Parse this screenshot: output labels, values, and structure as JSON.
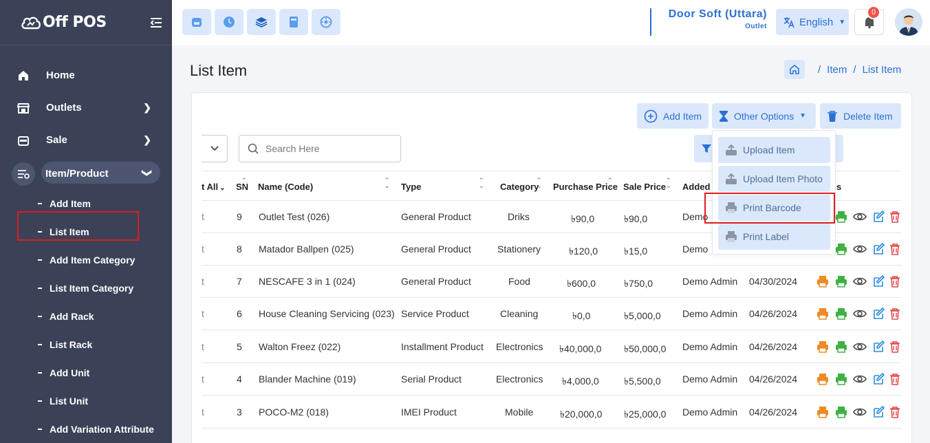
{
  "app": {
    "brand": "Off POS"
  },
  "sidebar": {
    "items": [
      {
        "label": "Home",
        "icon": "home-icon"
      },
      {
        "label": "Outlets",
        "icon": "store-icon"
      },
      {
        "label": "Sale",
        "icon": "register-icon"
      },
      {
        "label": "Item/Product",
        "icon": "list-icon"
      }
    ],
    "sub_items": [
      "Add Item",
      "List Item",
      "Add Item Category",
      "List Item Category",
      "Add Rack",
      "List Rack",
      "Add Unit",
      "List Unit",
      "Add Variation Attribute"
    ]
  },
  "topbar": {
    "outlet_name": "Door Soft (Uttara)",
    "outlet_type": "Outlet",
    "language": "English",
    "notification_count": "0"
  },
  "page": {
    "title": "List Item",
    "breadcrumb": [
      "Item",
      "List Item"
    ]
  },
  "actions": {
    "add_item": "Add Item",
    "other_options": "Other Options",
    "delete_item": "Delete Item",
    "menu": [
      "Upload Item",
      "Upload Item Photo",
      "Print Barcode",
      "Print Label"
    ]
  },
  "search": {
    "placeholder": "Search Here"
  },
  "table": {
    "headers": {
      "select_all": "t All",
      "sn": "SN",
      "name": "Name (Code)",
      "type": "Type",
      "category": "Category",
      "purchase_price": "Purchase Price",
      "sale_price": "Sale Price",
      "added": "Added",
      "actions": "ns"
    },
    "rows": [
      {
        "check": "t",
        "sn": "9",
        "name": "Outlet Test (026)",
        "type": "General Product",
        "category": "Driks",
        "purchase": "৳90,0",
        "sale": "৳90,0",
        "added_by": "Demo",
        "date": ""
      },
      {
        "check": "t",
        "sn": "8",
        "name": "Matador Ballpen (025)",
        "type": "General Product",
        "category": "Stationery",
        "purchase": "৳120,0",
        "sale": "৳15,0",
        "added_by": "Demo",
        "date": ""
      },
      {
        "check": "t",
        "sn": "7",
        "name": "NESCAFE 3 in 1 (024)",
        "type": "General Product",
        "category": "Food",
        "purchase": "৳600,0",
        "sale": "৳750,0",
        "added_by": "Demo Admin",
        "date": "04/30/2024"
      },
      {
        "check": "t",
        "sn": "6",
        "name": "House Cleaning Servicing (023)",
        "type": "Service Product",
        "category": "Cleaning",
        "purchase": "৳0,0",
        "sale": "৳5,000,0",
        "added_by": "Demo Admin",
        "date": "04/26/2024"
      },
      {
        "check": "t",
        "sn": "5",
        "name": "Walton Freez (022)",
        "type": "Installment Product",
        "category": "Electronics",
        "purchase": "৳40,000,0",
        "sale": "৳50,000,0",
        "added_by": "Demo Admin",
        "date": "04/26/2024"
      },
      {
        "check": "t",
        "sn": "4",
        "name": "Blander Machine (019)",
        "type": "Serial Product",
        "category": "Electronics",
        "purchase": "৳4,000,0",
        "sale": "৳5,500,0",
        "added_by": "Demo Admin",
        "date": "04/26/2024"
      },
      {
        "check": "t",
        "sn": "3",
        "name": "POCO-M2 (018)",
        "type": "IMEI Product",
        "category": "Mobile",
        "purchase": "৳20,000,0",
        "sale": "৳25,000,0",
        "added_by": "Demo Admin",
        "date": "04/26/2024"
      }
    ]
  },
  "colors": {
    "sidebar": "#3b4257",
    "accent": "#2c6fd4",
    "chip": "#dbe8fb",
    "highlight": "#e01b1b",
    "orange": "#f08a24",
    "green": "#3fb143",
    "red": "#e5484d"
  }
}
